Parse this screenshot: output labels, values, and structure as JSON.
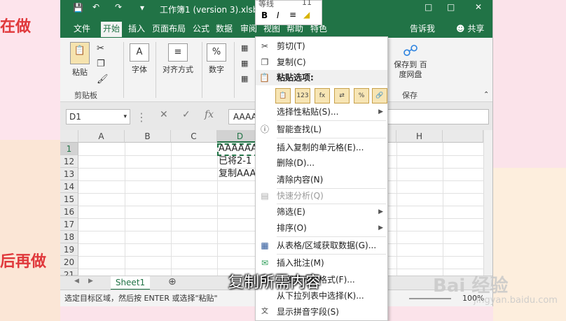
{
  "background": {
    "left_text_1": "在做",
    "left_text_2": "后再做"
  },
  "window": {
    "title": "工作簿1 (version 3).xlsb[E"
  },
  "tabs": [
    "文件",
    "开始",
    "插入",
    "页面布局",
    "公式",
    "数据",
    "审阅",
    "视图",
    "帮助",
    "特色",
    "告诉我",
    "共享"
  ],
  "ribbon": {
    "paste_label": "粘贴",
    "clipboard_label": "剪贴板",
    "font_label": "字体",
    "align_label": "对齐方式",
    "number_label": "数字",
    "baidu_save_label": "保存到 百度网盘",
    "save_group_label": "保存"
  },
  "minibar": {
    "font_box": "等线",
    "size_box": "11",
    "bold": "B",
    "italic": "I"
  },
  "formula_bar": {
    "name_box": "D1",
    "fx": "fx",
    "content": "AAAA"
  },
  "grid": {
    "columns": [
      "A",
      "B",
      "C",
      "D",
      "H"
    ],
    "rows": [
      "1",
      "12",
      "13",
      "14",
      "15",
      "16",
      "17",
      "18",
      "19",
      "20",
      "21"
    ],
    "cells": {
      "d1": "AAAAAA",
      "d12": "已将2-1",
      "d13": "复制AAA"
    }
  },
  "sheet": {
    "tab": "Sheet1"
  },
  "status": {
    "message": "选定目标区域，然后按 ENTER 或选择\"粘贴\"",
    "zoom": "100%"
  },
  "context_menu": {
    "cut": "剪切(T)",
    "copy": "复制(C)",
    "paste_options": "粘贴选项:",
    "paste_special": "选择性粘贴(S)...",
    "smart_lookup": "智能查找(L)",
    "insert_copied": "插入复制的单元格(E)...",
    "delete": "删除(D)...",
    "clear": "清除内容(N)",
    "quick_analysis": "快速分析(Q)",
    "filter": "筛选(E)",
    "sort": "排序(O)",
    "from_table": "从表格/区域获取数据(G)...",
    "insert_comment": "插入批注(M)",
    "format_cells": "设置单元格格式(F)...",
    "pick_list": "从下拉列表中选择(K)...",
    "phonetic": "显示拼音字段(S)"
  },
  "subtitle": "复制所需内容",
  "watermark": {
    "main": "Bai 经验",
    "url": "jingyan.baidu.com"
  }
}
